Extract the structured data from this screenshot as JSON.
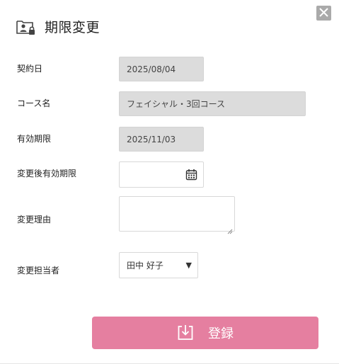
{
  "dialog": {
    "title": "期限変更",
    "title_icon": "folder-lock-user-icon",
    "close_icon": "close-icon"
  },
  "form": {
    "contract_date": {
      "label": "契約日",
      "value": "2025/08/04"
    },
    "course_name": {
      "label": "コース名",
      "value": "フェイシャル・3回コース"
    },
    "expiry_date": {
      "label": "有効期限",
      "value": "2025/11/03"
    },
    "new_expiry_date": {
      "label": "変更後有効期限",
      "value": "",
      "icon": "calendar-icon"
    },
    "change_reason": {
      "label": "変更理由",
      "value": ""
    },
    "staff": {
      "label": "変更担当者",
      "selected": "田中 好子",
      "caret": "▼"
    }
  },
  "submit": {
    "label": "登録",
    "icon": "download-box-icon"
  },
  "colors": {
    "accent": "#e57fa0",
    "readonly_bg": "#dcdcdc",
    "close_bg": "#aaaaaa"
  }
}
